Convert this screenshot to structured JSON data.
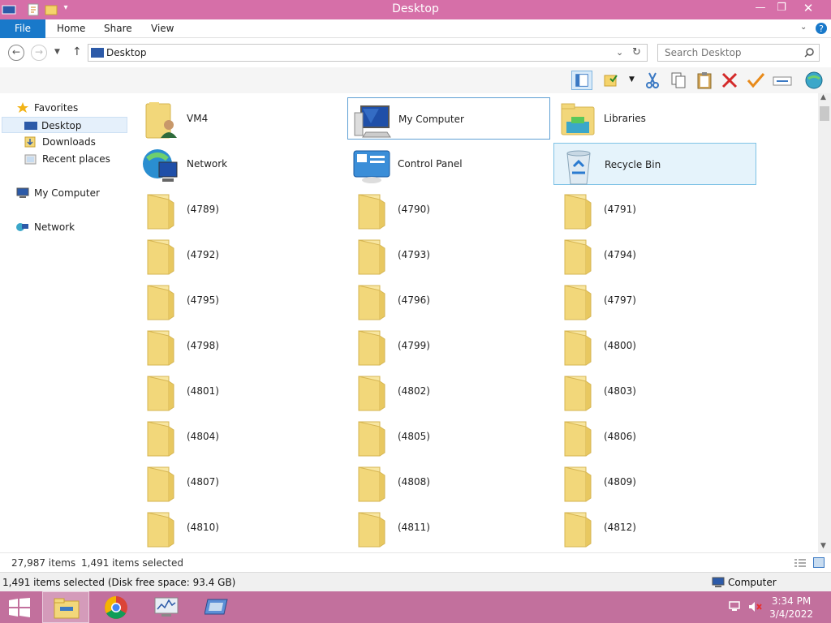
{
  "window": {
    "title": "Desktop"
  },
  "ribbon": {
    "tabs": [
      "File",
      "Home",
      "Share",
      "View"
    ]
  },
  "address": {
    "path": "Desktop"
  },
  "search": {
    "placeholder": "Search Desktop"
  },
  "nav": {
    "favorites_label": "Favorites",
    "favorites": [
      "Desktop",
      "Downloads",
      "Recent places"
    ],
    "my_computer": "My Computer",
    "network": "Network",
    "selected": "Desktop"
  },
  "items": [
    {
      "label": "VM4",
      "icon": "user-folder-icon"
    },
    {
      "label": "My Computer",
      "icon": "computer-icon",
      "state": "focused"
    },
    {
      "label": "Libraries",
      "icon": "libraries-icon"
    },
    {
      "label": "Network",
      "icon": "network-icon"
    },
    {
      "label": "Control Panel",
      "icon": "control-panel-icon"
    },
    {
      "label": "Recycle Bin",
      "icon": "recycle-bin-icon",
      "state": "selected"
    },
    {
      "label": "(4789)"
    },
    {
      "label": "(4790)"
    },
    {
      "label": "(4791)"
    },
    {
      "label": "(4792)"
    },
    {
      "label": "(4793)"
    },
    {
      "label": "(4794)"
    },
    {
      "label": "(4795)"
    },
    {
      "label": "(4796)"
    },
    {
      "label": "(4797)"
    },
    {
      "label": "(4798)"
    },
    {
      "label": "(4799)"
    },
    {
      "label": "(4800)"
    },
    {
      "label": "(4801)"
    },
    {
      "label": "(4802)"
    },
    {
      "label": "(4803)"
    },
    {
      "label": "(4804)"
    },
    {
      "label": "(4805)"
    },
    {
      "label": "(4806)"
    },
    {
      "label": "(4807)"
    },
    {
      "label": "(4808)"
    },
    {
      "label": "(4809)"
    },
    {
      "label": "(4810)"
    },
    {
      "label": "(4811)"
    },
    {
      "label": "(4812)"
    }
  ],
  "status": {
    "item_count": "27,987 items",
    "selected_count": "1,491 items selected",
    "detail": "1,491 items selected (Disk free space: 93.4 GB)",
    "location": "Computer"
  },
  "taskbar": {
    "time": "3:34 PM",
    "date": "3/4/2022"
  },
  "colors": {
    "title_bar": "#d66fa8",
    "taskbar": "#c2709d",
    "file_tab": "#1979ca",
    "folder": "#f2d77a"
  }
}
